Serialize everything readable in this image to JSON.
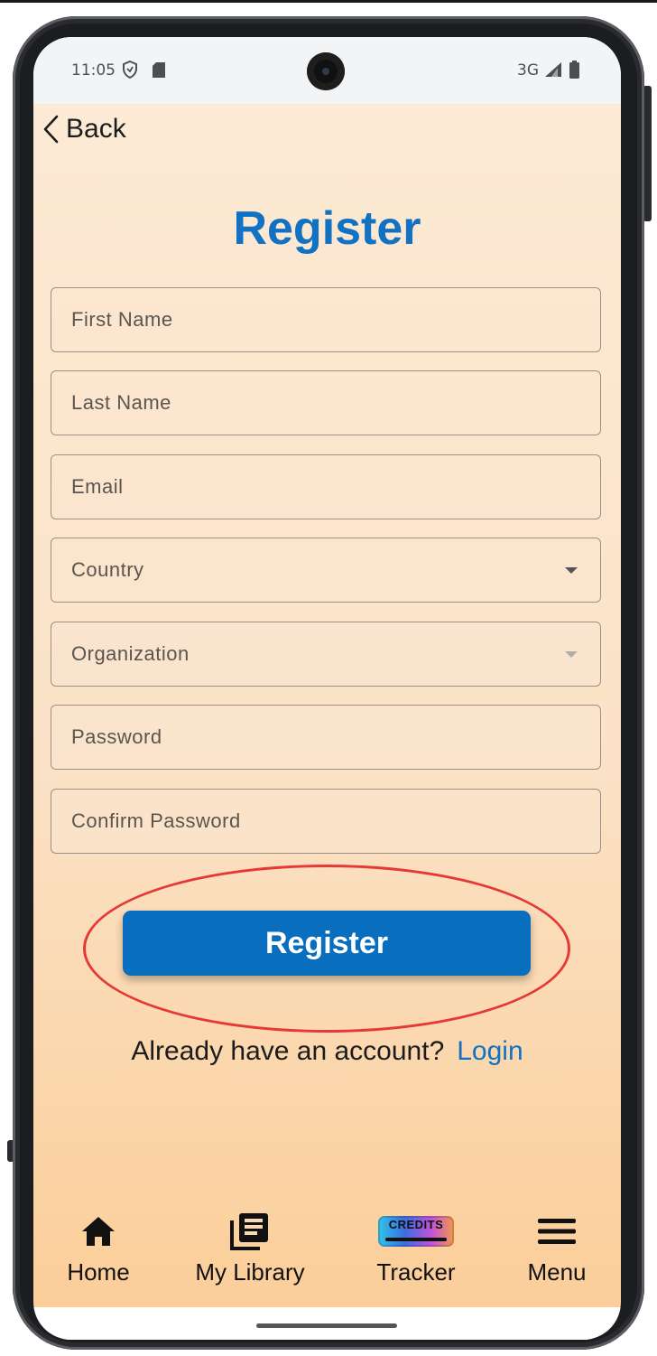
{
  "status_bar": {
    "time": "11:05",
    "network": "3G",
    "icons": [
      "shield-icon",
      "sd-card-icon",
      "signal-icon",
      "battery-icon"
    ]
  },
  "header": {
    "back_label": "Back"
  },
  "page": {
    "title": "Register"
  },
  "form": {
    "first_name_placeholder": "First Name",
    "last_name_placeholder": "Last Name",
    "email_placeholder": "Email",
    "country_label": "Country",
    "organization_label": "Organization",
    "password_placeholder": "Password",
    "confirm_password_placeholder": "Confirm Password",
    "submit_label": "Register"
  },
  "footer": {
    "prompt": "Already have an account?",
    "login_label": "Login"
  },
  "bottom_nav": {
    "items": [
      {
        "label": "Home",
        "icon": "home-icon"
      },
      {
        "label": "My Library",
        "icon": "library-icon"
      },
      {
        "label": "Tracker",
        "icon": "credits-icon",
        "badge_text": "CREDITS"
      },
      {
        "label": "Menu",
        "icon": "hamburger-menu-icon"
      }
    ]
  },
  "colors": {
    "accent": "#1171c3",
    "button": "#0a6ebf",
    "highlight_ring": "#e53935",
    "background_top": "#fdebd6",
    "background_bottom": "#fbcd96"
  }
}
